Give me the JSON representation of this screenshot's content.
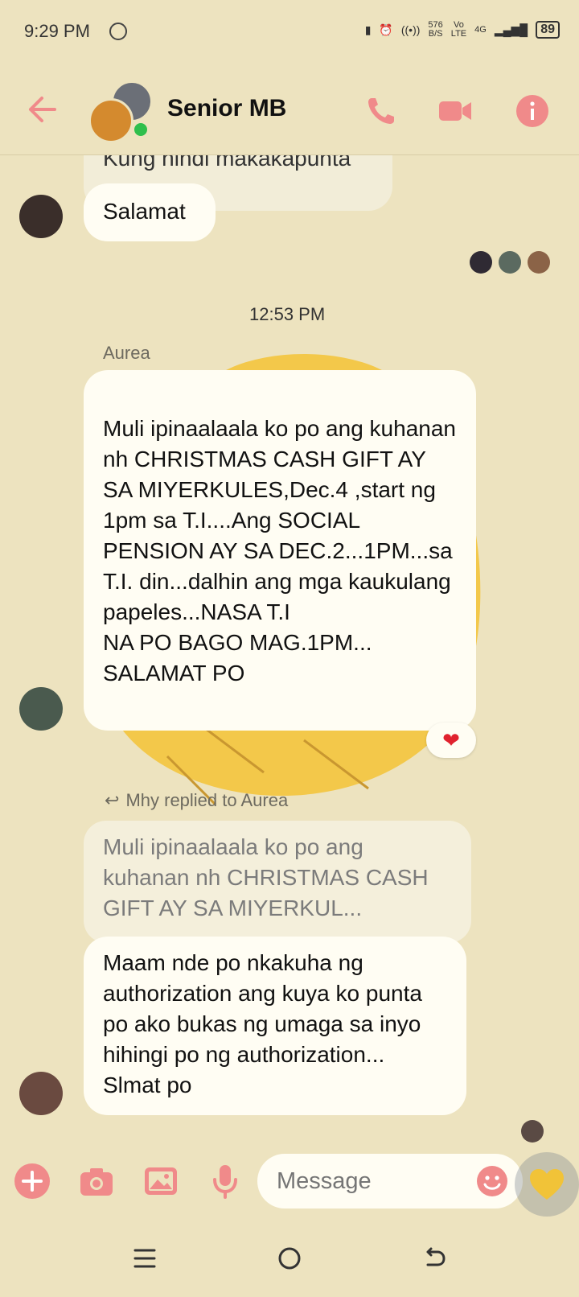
{
  "status_bar": {
    "time": "9:29 PM",
    "net_speed_top": "576",
    "net_speed_bottom": "B/S",
    "volte_top": "Vo",
    "volte_bottom": "LTE",
    "network": "4G",
    "battery": "89"
  },
  "header": {
    "title": "Senior MB"
  },
  "messages": {
    "prev_cut_text": "Kung hindi makakapunta",
    "salamat": "Salamat",
    "timestamp": "12:53 PM",
    "aurea_sender": "Aurea",
    "aurea_text": "Muli ipinaalaala ko po ang kuhanan nh CHRISTMAS CASH GIFT AY SA MIYERKULES,Dec.4 ,start ng 1pm sa T.I....Ang SOCIAL PENSION AY SA DEC.2...1PM...sa T.I. din...dalhin ang mga kaukulang papeles...NASA T.I\n NA PO BAGO MAG.1PM... SALAMAT PO",
    "aurea_reaction": "❤",
    "reply_note": "Mhy replied to Aurea",
    "quoted_text": "Muli ipinaalaala ko po ang kuhanan nh CHRISTMAS CASH GIFT AY SA MIYERKUL...",
    "mhy_text": "Maam nde po nkakuha ng authorization ang kuya ko punta po ako bukas ng umaga sa inyo hihingi po ng authorization... Slmat po"
  },
  "composer": {
    "placeholder": "Message"
  },
  "colors": {
    "accent": "#f08a8a",
    "background": "#ede3bf",
    "bubble": "#fffdf3",
    "online": "#2fbf4c"
  }
}
